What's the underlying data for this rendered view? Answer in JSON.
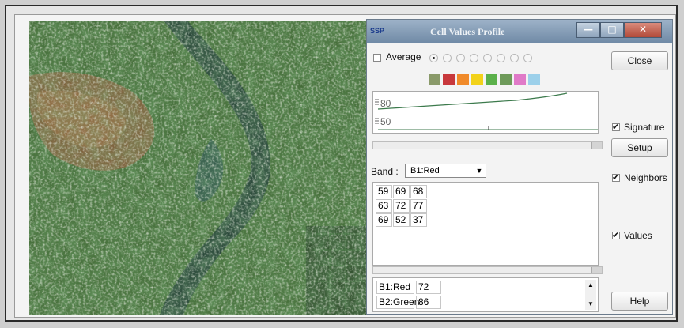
{
  "window": {
    "title": "Cell Values Profile",
    "logo": "SSP"
  },
  "titlebar_icons": {
    "minimize": "minimize-icon",
    "maximize": "maximize-icon",
    "close": "close-icon"
  },
  "controls": {
    "average_label": "Average",
    "close_label": "Close",
    "signature_label": "Signature",
    "setup_label": "Setup",
    "neighbors_label": "Neighbors",
    "values_label": "Values",
    "help_label": "Help",
    "signature_checked": true,
    "neighbors_checked": true,
    "values_checked": true,
    "average_checked": false
  },
  "radio_selected_index": 0,
  "swatch_colors": [
    "#8a9a6a",
    "#c8383c",
    "#f08a2a",
    "#f2d21a",
    "#5bb04a",
    "#6e9a5a",
    "#e07ac8",
    "#9cd0ea"
  ],
  "profile_chart": {
    "tick_labels": [
      "80",
      "50"
    ],
    "line_color": "#3c7a4c"
  },
  "band": {
    "label": "Band :",
    "selected": "B1:Red"
  },
  "neighbor_values": [
    [
      "59",
      "69",
      "68"
    ],
    [
      "63",
      "72",
      "77"
    ],
    [
      "69",
      "52",
      "37"
    ]
  ],
  "value_list": [
    {
      "band": "B1:Red",
      "value": "72"
    },
    {
      "band": "B2:Green",
      "value": "86"
    }
  ]
}
